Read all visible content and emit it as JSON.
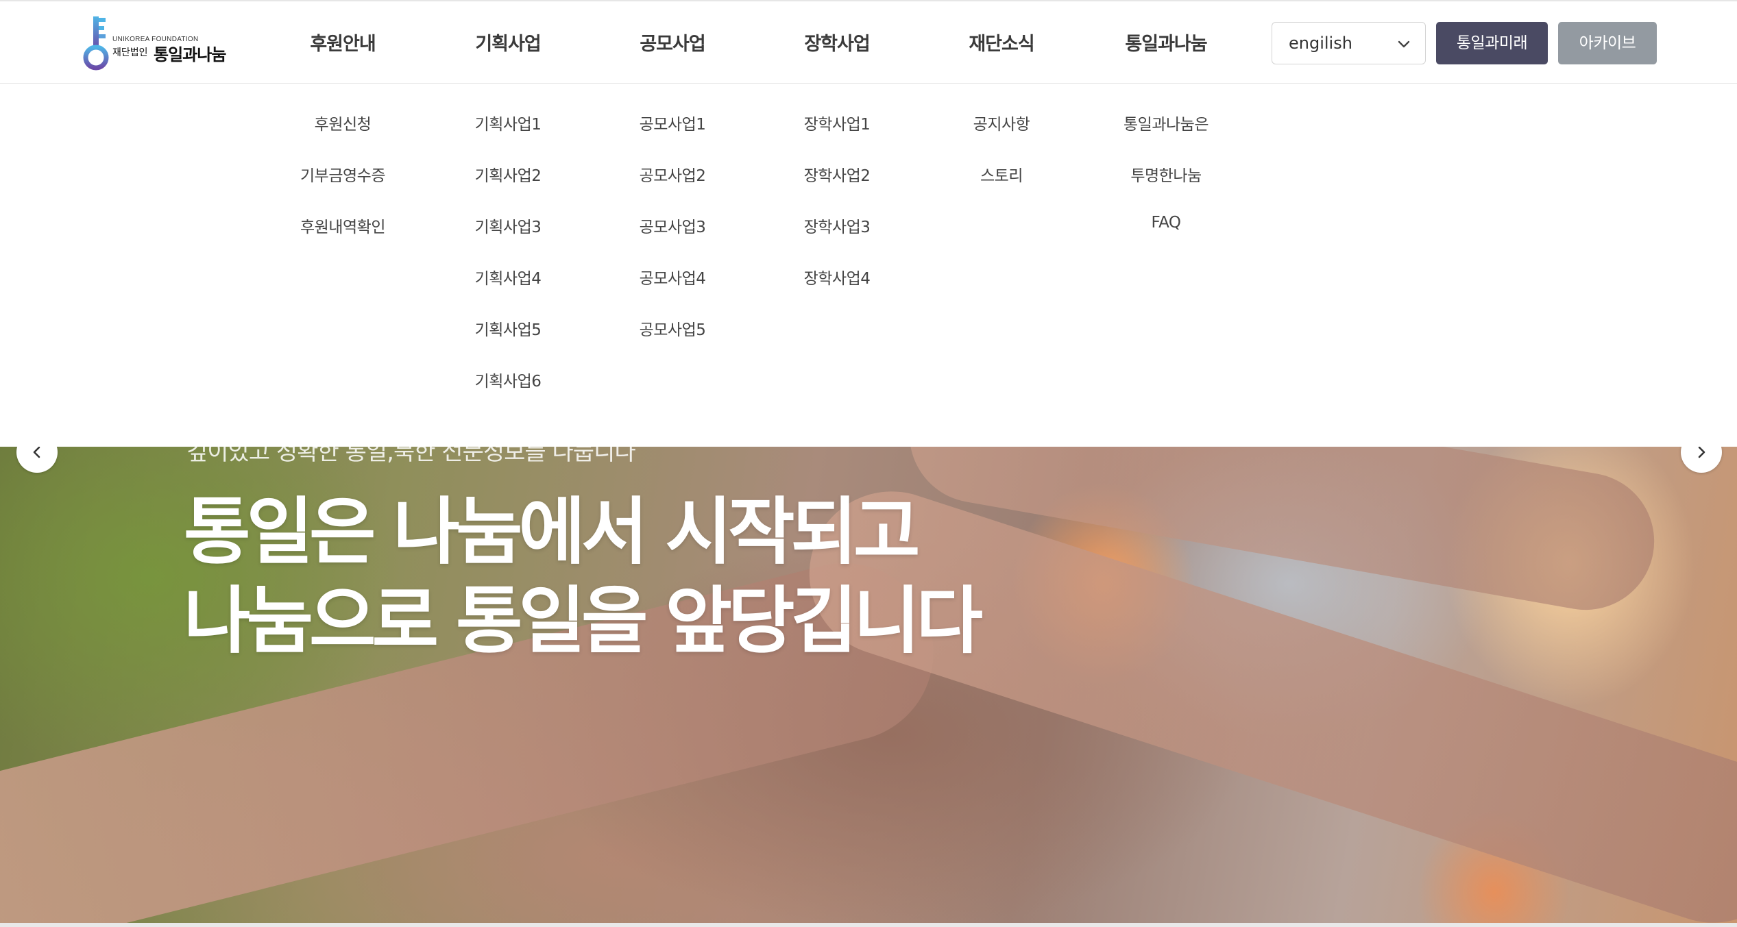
{
  "logo": {
    "org_en": "UNIKOREA FOUNDATION",
    "tag": "재단법인",
    "name": "통일과나눔"
  },
  "gnb": [
    {
      "label": "후원안내",
      "submenu": [
        "후원신청",
        "기부금영수증",
        "후원내역확인"
      ]
    },
    {
      "label": "기획사업",
      "submenu": [
        "기획사업1",
        "기획사업2",
        "기획사업3",
        "기획사업4",
        "기획사업5",
        "기획사업6"
      ]
    },
    {
      "label": "공모사업",
      "submenu": [
        "공모사업1",
        "공모사업2",
        "공모사업3",
        "공모사업4",
        "공모사업5"
      ]
    },
    {
      "label": "장학사업",
      "submenu": [
        "장학사업1",
        "장학사업2",
        "장학사업3",
        "장학사업4"
      ]
    },
    {
      "label": "재단소식",
      "submenu": [
        "공지사항",
        "스토리"
      ]
    },
    {
      "label": "통일과나눔",
      "submenu": [
        "통일과나눔은",
        "투명한나눔",
        "FAQ"
      ]
    }
  ],
  "language": {
    "selected": "engilish",
    "icon": "chevron-down-icon"
  },
  "buttons": {
    "future": "통일과미래",
    "archive": "아카이브"
  },
  "hero": {
    "subtitle": "깊이있고 정확한 통일,북한 전문정보를 나눕니다",
    "title_line1": "통일은 나눔에서 시작되고",
    "title_line2": "나눔으로 통일을 앞당깁니다"
  },
  "carousel": {
    "prev_icon": "chevron-left-icon",
    "next_icon": "chevron-right-icon"
  },
  "colors": {
    "future_button": "#4a4a63",
    "archive_button": "#939aa1",
    "logo_key_blue": "#4fb4e6",
    "logo_key_purple": "#6a4aa8"
  }
}
